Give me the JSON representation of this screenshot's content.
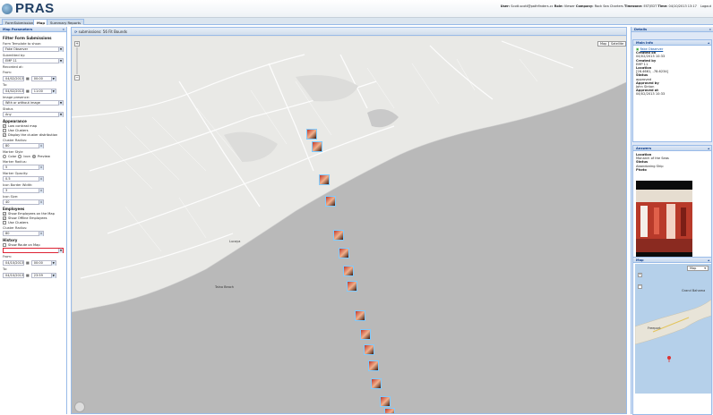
{
  "app": {
    "title": "PRAS"
  },
  "user": {
    "user_label": "User:",
    "user_value": "Scott.scott@pathfinders.cc",
    "role_label": "Role:",
    "role_value": "Viewer",
    "company_label": "Company:",
    "company_value": "Rock Sea Charters",
    "tz_label": "Timezone:",
    "tz_value": "EST/EDT",
    "time_label": "Time:",
    "time_value": "04/10/2013 13:17",
    "logout": "Logout"
  },
  "tabs": [
    "FormSubmissions",
    "Map",
    "Summary Reports"
  ],
  "left": {
    "title": "Map Parameters",
    "filter_title": "Filter Form Submissions",
    "form_label": "Form Template to show:",
    "form_value": "Fake Observer",
    "submitted_label": "Submitted by:",
    "submitted_value": "EMP 11",
    "recorded_label": "Recorded at:",
    "from_label": "From:",
    "from_date": "04/02/2013",
    "from_time": "00:00",
    "to_label": "To:",
    "to_date": "04/02/2013",
    "to_time": "11:00",
    "image_label": "Image presence:",
    "image_value": "With or without image",
    "status_label": "Status",
    "status_value": "Any",
    "appearance_title": "Appearance",
    "low_contrast": "Low contrast map",
    "use_clusters": "Use Clusters",
    "display_dist": "Display the cluster distribution",
    "cluster_radius_label": "Cluster Radius:",
    "cluster_radius_value": "80",
    "marker_style_label": "Marker Style",
    "style_color": "Color",
    "style_icon": "Icon",
    "style_preview": "Preview",
    "marker_radius_label": "Marker Radius:",
    "marker_radius_value": "5",
    "marker_opacity_label": "Marker Opacity:",
    "marker_opacity_value": "0.5",
    "icon_border_label": "Icon Border Width:",
    "icon_border_value": "3",
    "icon_size_label": "Icon Size:",
    "icon_size_value": "40",
    "employees_title": "Employees",
    "show_emp": "Show Employees on the Map",
    "show_offline": "Show Offline Employees",
    "emp_clusters": "Use Clusters",
    "emp_cluster_radius_label": "Cluster Radius:",
    "emp_cluster_radius_value": "80",
    "history_title": "History",
    "show_route": "Show Route on Map",
    "h_from_label": "From:",
    "h_from_date": "04/10/2013",
    "h_from_time": "00:00",
    "h_to_label": "To:",
    "h_to_date": "04/10/2013",
    "h_to_time": "23:59"
  },
  "map": {
    "status_text": "submissions: 56   Fit Bounds",
    "btn_map": "Map",
    "btn_satellite": "Satellite",
    "labels": [
      "Freeport",
      "Grand Bahama",
      "Lucaya",
      "Taino Beach"
    ]
  },
  "right": {
    "title": "Details",
    "main_info_title": "Main Info",
    "form_name": "Fake Observer",
    "created_on_label": "Created on",
    "created_on_value": "04/02/2013 10:33",
    "created_by_label": "Created by",
    "created_by_value": "EMP 11",
    "location_label": "Location",
    "location_value": "[26.4661, -78.6234]",
    "status_label": "Status",
    "status_value": "approved",
    "approved_by_label": "Approved by",
    "approved_by_value": "John Sinton",
    "approved_at_label": "Approved at",
    "approved_at_value": "04/02/2013 10:33",
    "answers_title": "Answers",
    "a_location_label": "Location",
    "a_location_value": "Monarch of the Seas",
    "a_status_label": "Status",
    "a_status_value": "Abandoning Ship",
    "a_photo_label": "Photo",
    "comment_label": "Comment",
    "minimap_title": "Map",
    "minimap_select": "Map",
    "minimap_labels": [
      "Grand Bahama",
      "Freeport"
    ]
  },
  "colors": {
    "accent": "#15428b",
    "header_bg": "#dfe8f6",
    "marker_border": "#7ecbff"
  }
}
